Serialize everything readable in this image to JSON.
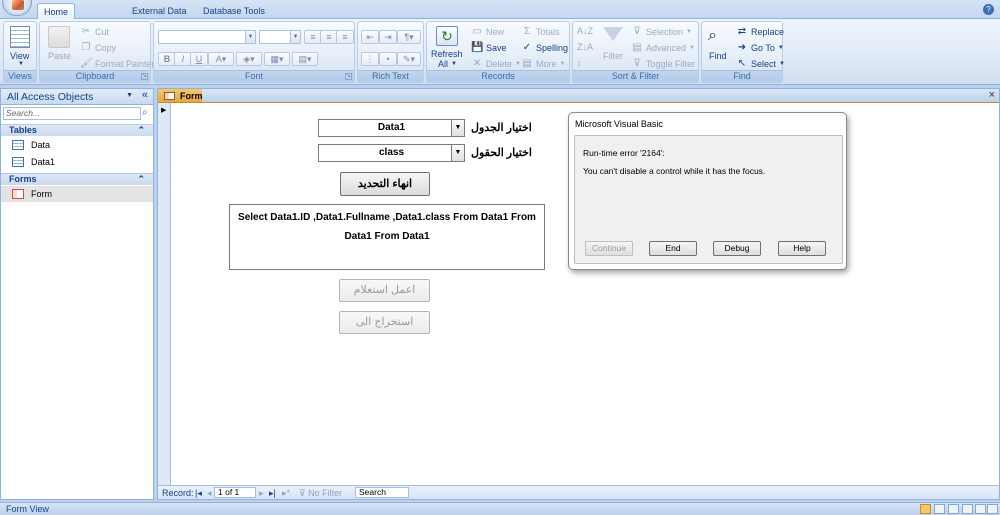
{
  "ribbon": {
    "tabs": [
      "Home",
      "External Data",
      "Database Tools"
    ],
    "groups": {
      "views": {
        "label": "Views",
        "view_button": "View"
      },
      "clipboard": {
        "label": "Clipboard",
        "paste": "Paste",
        "cut": "Cut",
        "copy": "Copy",
        "format_painter": "Format Painter"
      },
      "font": {
        "label": "Font"
      },
      "rich_text": {
        "label": "Rich Text"
      },
      "records": {
        "label": "Records",
        "refresh": "Refresh",
        "refresh_all": "All",
        "new": "New",
        "save": "Save",
        "delete": "Delete",
        "totals": "Totals",
        "spelling": "Spelling",
        "more": "More"
      },
      "sort_filter": {
        "label": "Sort & Filter",
        "filter": "Filter",
        "selection": "Selection",
        "advanced": "Advanced",
        "toggle_filter": "Toggle Filter"
      },
      "find": {
        "label": "Find",
        "find": "Find",
        "replace": "Replace",
        "go_to": "Go To",
        "select": "Select"
      }
    }
  },
  "nav_pane": {
    "title": "All Access Objects",
    "search_placeholder": "Search...",
    "sections": [
      {
        "name": "Tables",
        "items": [
          "Data",
          "Data1"
        ]
      },
      {
        "name": "Forms",
        "items": [
          "Form"
        ]
      }
    ]
  },
  "document": {
    "tab_label": "Form",
    "form": {
      "table_label": "اختيار الجدول",
      "table_value": "Data1",
      "fields_label": "اختيار الحقول",
      "fields_value": "class",
      "end_selection_button": "انهاء التحديد",
      "sql_line1": "Select Data1.ID ,Data1.Fullname ,Data1.class From Data1 From",
      "sql_line2": "Data1 From Data1",
      "run_query_button": "اعمل استعلام",
      "extract_button": "استخراج الى"
    },
    "record_nav": {
      "label": "Record:",
      "position": "1 of 1",
      "no_filter": "No Filter",
      "search": "Search"
    }
  },
  "dialog": {
    "title": "Microsoft Visual Basic",
    "error_line": "Run-time error '2164':",
    "message": "You can't disable a control while it has the focus.",
    "buttons": [
      "Continue",
      "End",
      "Debug",
      "Help"
    ]
  },
  "status_bar": {
    "text": "Form View"
  },
  "colors": {
    "ribbon_text": "#15428b",
    "form_tab_accent": "#e7a73d",
    "frame": "#bcd1ea"
  }
}
